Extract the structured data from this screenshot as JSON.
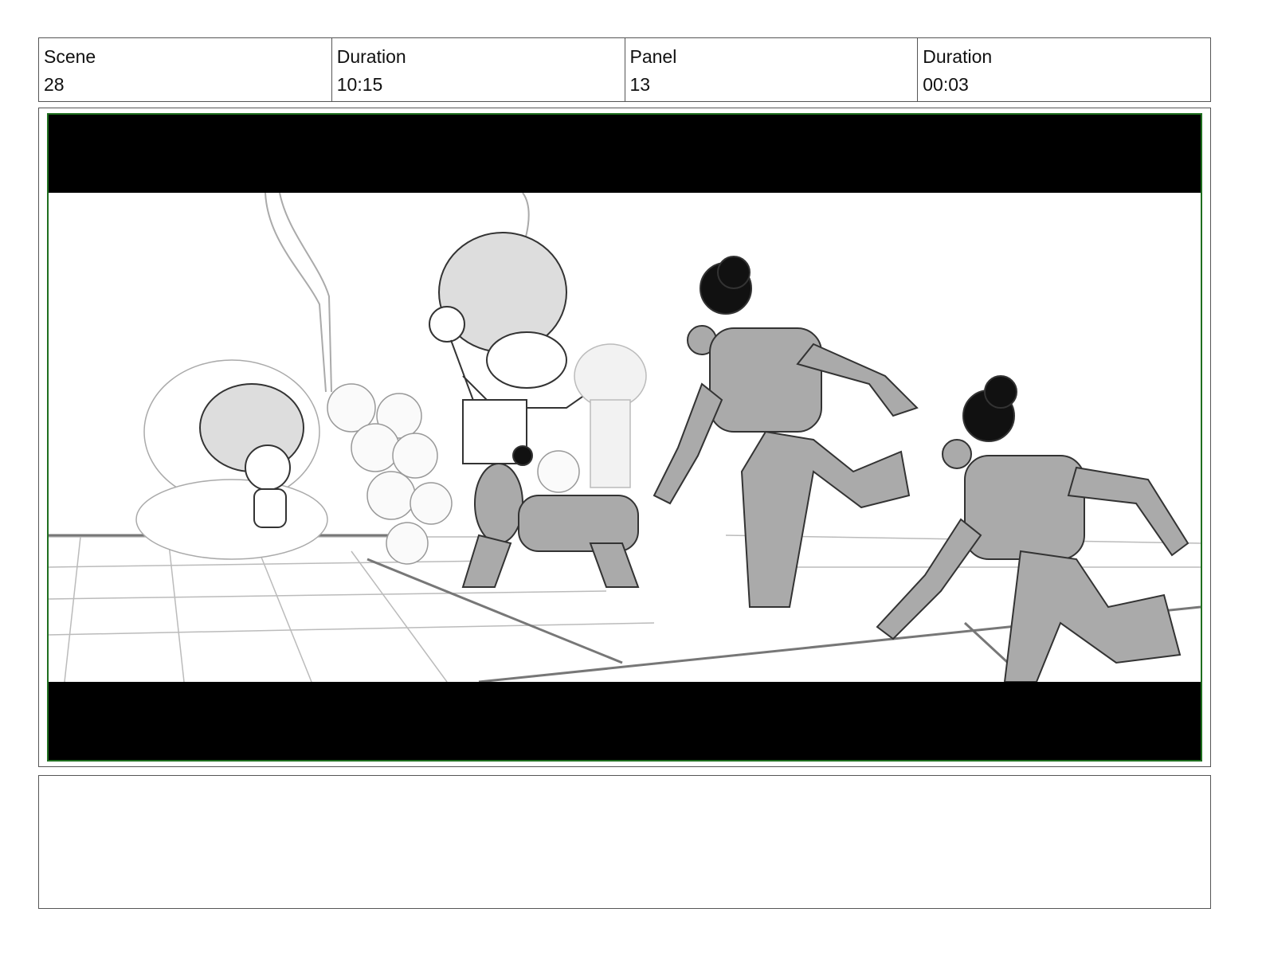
{
  "header": {
    "scene_label": "Scene",
    "scene_value": "28",
    "duration_label": "Duration",
    "duration_value": "10:15",
    "panel_label": "Panel",
    "panel_value": "13",
    "panel_duration_label": "Duration",
    "panel_duration_value": "00:03"
  },
  "panel": {
    "frame_border_color": "#1f6f1f",
    "letterbox_color": "#000000"
  },
  "notes": {
    "text": ""
  }
}
